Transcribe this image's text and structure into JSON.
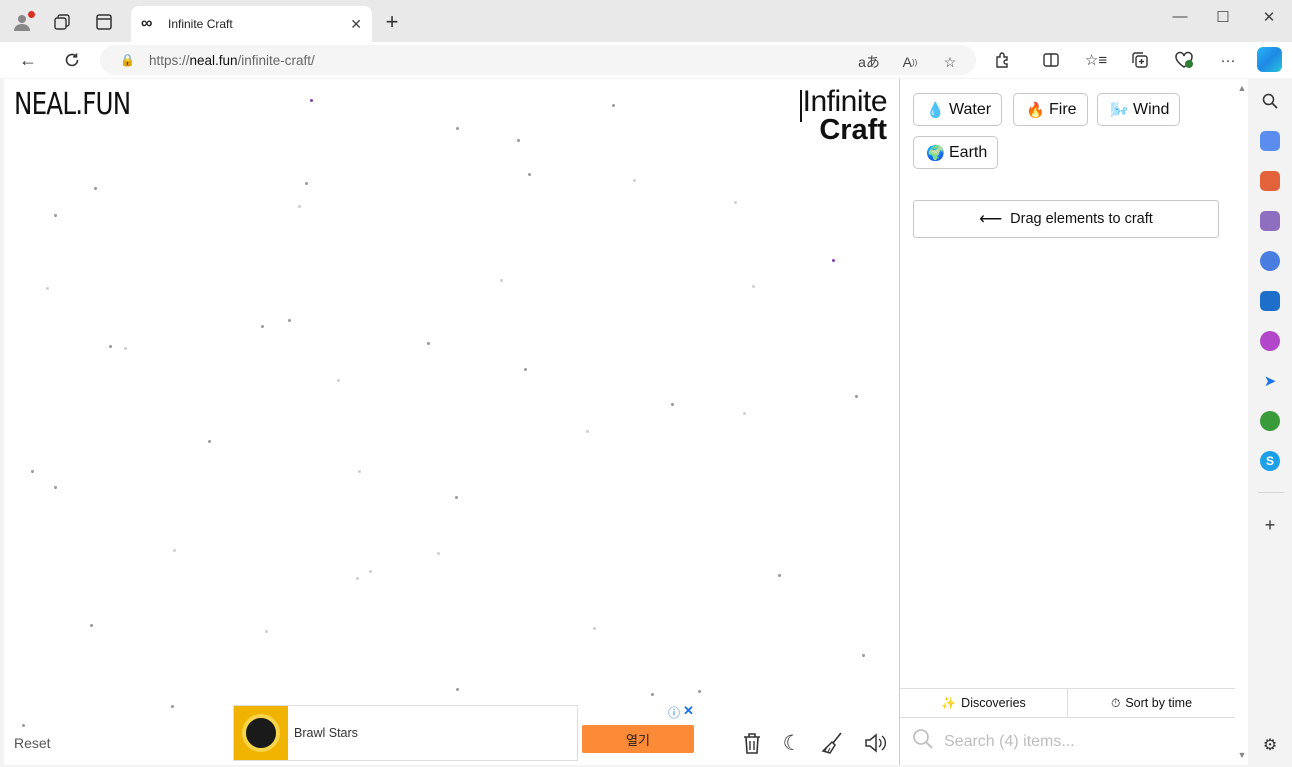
{
  "browser": {
    "tab_title": "Infinite Craft",
    "new_tab": "+",
    "url_scheme": "https://",
    "url_host": "neal.fun",
    "url_path": "/infinite-craft/"
  },
  "page": {
    "brand": "NEAL.FUN",
    "logo_line1": "Infinite",
    "logo_line2": "Craft",
    "reset_label": "Reset"
  },
  "ad": {
    "app_name": "Brawl Stars",
    "button_label": "열기"
  },
  "sidebar": {
    "items": [
      {
        "emoji": "💧",
        "label": "Water"
      },
      {
        "emoji": "🔥",
        "label": "Fire"
      },
      {
        "emoji": "🌬️",
        "label": "Wind"
      },
      {
        "emoji": "🌍",
        "label": "Earth"
      }
    ],
    "drag_hint": "Drag elements to craft",
    "discoveries_label": "Discoveries",
    "sort_label": "Sort by time",
    "search_placeholder": "Search (4) items..."
  }
}
